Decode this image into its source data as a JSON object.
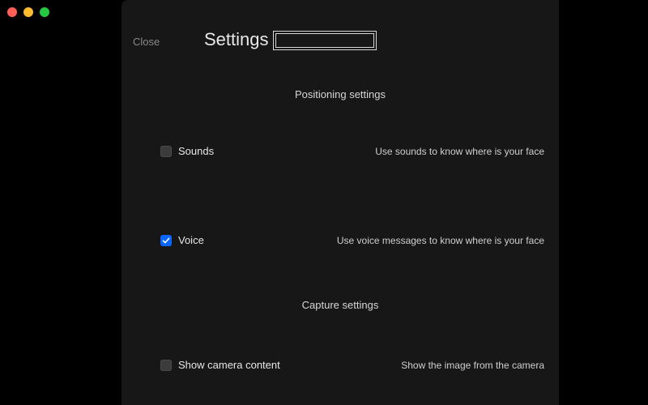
{
  "window": {
    "close_label": "Close",
    "title": "Settings"
  },
  "sections": {
    "positioning": "Positioning settings",
    "capture": "Capture settings"
  },
  "settings": {
    "sounds": {
      "label": "Sounds",
      "description": "Use sounds to know where is your face",
      "checked": false
    },
    "voice": {
      "label": "Voice",
      "description": "Use voice messages to know where is your face",
      "checked": true
    },
    "show_camera": {
      "label": "Show camera content",
      "description": "Show the image from the camera",
      "checked": false
    }
  },
  "colors": {
    "accent": "#0a66ff",
    "panel_bg": "#171717",
    "text": "#e6e6e6",
    "muted": "#8a8a8a"
  }
}
